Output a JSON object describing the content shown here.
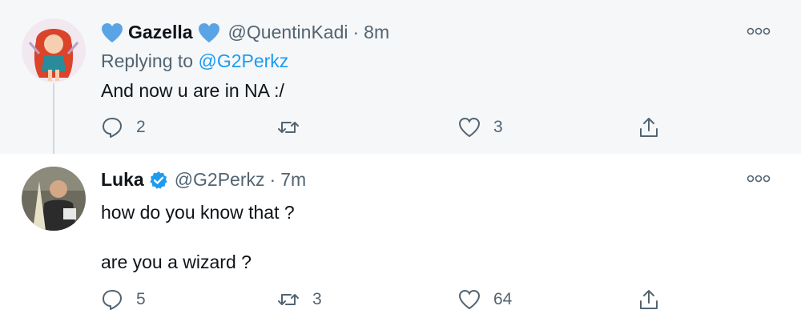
{
  "tweets": [
    {
      "display_name": "Gazella",
      "handle": "@QuentinKadi",
      "separator": "·",
      "time": "8m",
      "replying_prefix": "Replying to",
      "replying_to": "@G2Perkz",
      "text": "And now u are in NA :/",
      "counts": {
        "reply": "2",
        "retweet": "",
        "like": "3"
      },
      "icons": [
        "heart-icon",
        "more-icon",
        "reply-icon",
        "retweet-icon",
        "like-icon",
        "share-icon"
      ]
    },
    {
      "display_name": "Luka",
      "handle": "@G2Perkz",
      "separator": "·",
      "time": "7m",
      "text_line1": "how do you know that ?",
      "text_line2": "are you a wizard ?",
      "counts": {
        "reply": "5",
        "retweet": "3",
        "like": "64"
      },
      "icons": [
        "verified-icon",
        "more-icon",
        "reply-icon",
        "retweet-icon",
        "like-icon",
        "share-icon"
      ]
    }
  ],
  "colors": {
    "accent": "#1d9bf0",
    "muted": "#536471",
    "text": "#0f1419"
  }
}
